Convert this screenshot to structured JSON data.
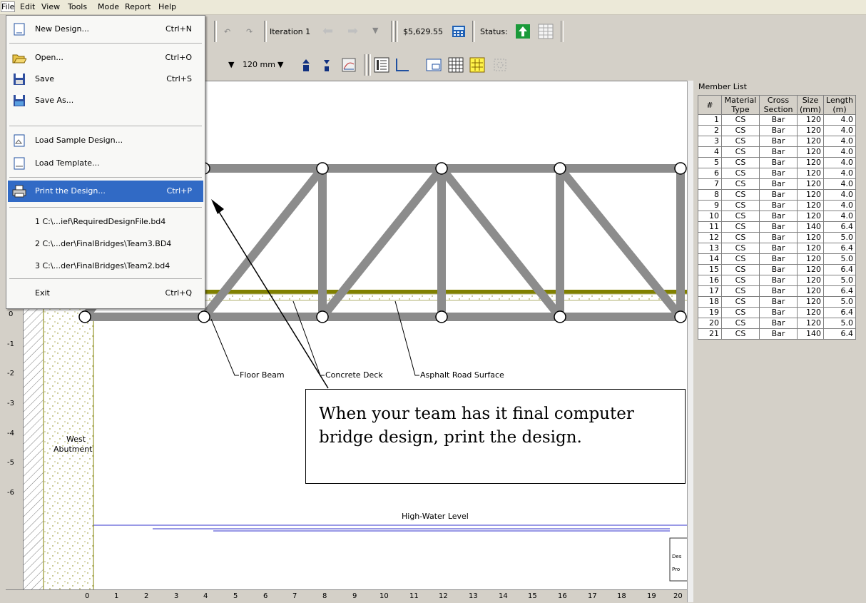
{
  "menubar": {
    "items": [
      "File",
      "Edit",
      "View",
      "Tools",
      "Mode",
      "Report",
      "Help"
    ]
  },
  "toolbar": {
    "iteration_label": "Iteration 1",
    "cost": "$5,629.55",
    "status_label": "Status:",
    "member_size": "120 mm"
  },
  "file_menu": {
    "items": [
      {
        "label": "New Design...",
        "shortcut": "Ctrl+N",
        "icon": "new-document-icon"
      },
      {
        "label": "Open...",
        "shortcut": "Ctrl+O",
        "icon": "open-folder-icon"
      },
      {
        "label": "Save",
        "shortcut": "Ctrl+S",
        "icon": "floppy-disk-icon"
      },
      {
        "label": "Save As...",
        "shortcut": "",
        "icon": "save-as-icon"
      },
      {
        "label": "Load Sample Design...",
        "shortcut": "",
        "icon": "sample-design-icon"
      },
      {
        "label": "Load Template...",
        "shortcut": "",
        "icon": "template-icon"
      },
      {
        "label": "Print the Design...",
        "shortcut": "Ctrl+P",
        "icon": "printer-icon"
      },
      {
        "label": "1 C:\\...ief\\RequiredDesignFile.bd4",
        "shortcut": "",
        "icon": ""
      },
      {
        "label": "2 C:\\...der\\FinalBridges\\Team3.BD4",
        "shortcut": "",
        "icon": ""
      },
      {
        "label": "3 C:\\...der\\FinalBridges\\Team2.bd4",
        "shortcut": "",
        "icon": ""
      },
      {
        "label": "Exit",
        "shortcut": "Ctrl+Q",
        "icon": ""
      }
    ]
  },
  "drawing": {
    "labels": {
      "floor_beam": "Floor Beam",
      "concrete_deck": "Concrete Deck",
      "asphalt": "Asphalt Road Surface",
      "high_water": "High-Water Level",
      "west": "West",
      "abutment": "Abutment"
    },
    "vertical_ruler": [
      "0",
      "-1",
      "-2",
      "-3",
      "-4",
      "-5",
      "-6"
    ],
    "horizontal_ruler": [
      "0",
      "1",
      "2",
      "3",
      "4",
      "5",
      "6",
      "7",
      "8",
      "9",
      "10",
      "11",
      "12",
      "13",
      "14",
      "15",
      "16",
      "17",
      "18",
      "19",
      "20"
    ],
    "title_block": [
      "Des",
      "Pro"
    ]
  },
  "callout": {
    "text": "When your team has it final computer bridge design, print the design."
  },
  "member_list": {
    "title": "Member List",
    "headers": [
      "#",
      "Material Type",
      "Cross Section",
      "Size (mm)",
      "Length (m)"
    ],
    "rows": [
      [
        "1",
        "CS",
        "Bar",
        "120",
        "4.0"
      ],
      [
        "2",
        "CS",
        "Bar",
        "120",
        "4.0"
      ],
      [
        "3",
        "CS",
        "Bar",
        "120",
        "4.0"
      ],
      [
        "4",
        "CS",
        "Bar",
        "120",
        "4.0"
      ],
      [
        "5",
        "CS",
        "Bar",
        "120",
        "4.0"
      ],
      [
        "6",
        "CS",
        "Bar",
        "120",
        "4.0"
      ],
      [
        "7",
        "CS",
        "Bar",
        "120",
        "4.0"
      ],
      [
        "8",
        "CS",
        "Bar",
        "120",
        "4.0"
      ],
      [
        "9",
        "CS",
        "Bar",
        "120",
        "4.0"
      ],
      [
        "10",
        "CS",
        "Bar",
        "120",
        "4.0"
      ],
      [
        "11",
        "CS",
        "Bar",
        "140",
        "6.4"
      ],
      [
        "12",
        "CS",
        "Bar",
        "120",
        "5.0"
      ],
      [
        "13",
        "CS",
        "Bar",
        "120",
        "6.4"
      ],
      [
        "14",
        "CS",
        "Bar",
        "120",
        "5.0"
      ],
      [
        "15",
        "CS",
        "Bar",
        "120",
        "6.4"
      ],
      [
        "16",
        "CS",
        "Bar",
        "120",
        "5.0"
      ],
      [
        "17",
        "CS",
        "Bar",
        "120",
        "6.4"
      ],
      [
        "18",
        "CS",
        "Bar",
        "120",
        "5.0"
      ],
      [
        "19",
        "CS",
        "Bar",
        "120",
        "6.4"
      ],
      [
        "20",
        "CS",
        "Bar",
        "120",
        "5.0"
      ],
      [
        "21",
        "CS",
        "Bar",
        "140",
        "6.4"
      ]
    ]
  },
  "colors": {
    "member": "#8c8c8c",
    "highlight": "#316ac5",
    "deck": "#808000",
    "water": "#3333cc"
  }
}
